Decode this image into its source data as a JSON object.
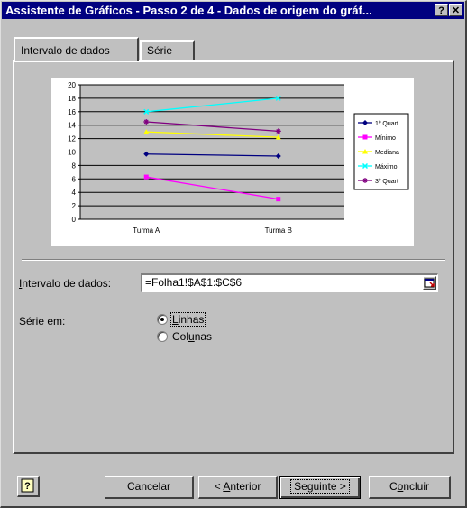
{
  "window": {
    "title": "Assistente de Gráficos - Passo 2 de 4 - Dados de origem do gráf...",
    "help_glyph": "?",
    "close_glyph": "✕"
  },
  "tabs": [
    {
      "label": "Intervalo de dados",
      "active": true
    },
    {
      "label": "Série",
      "active": false
    }
  ],
  "chart_data": {
    "type": "line",
    "categories": [
      "Turma A",
      "Turma B"
    ],
    "ylim": [
      0,
      20
    ],
    "yticks": [
      "0",
      "2",
      "4",
      "6",
      "8",
      "10",
      "12",
      "14",
      "16",
      "18",
      "20"
    ],
    "grid": true,
    "legend_position": "right",
    "series": [
      {
        "name": "1º Quart",
        "values": [
          9.7,
          9.4
        ],
        "color": "#000080",
        "marker": "diamond"
      },
      {
        "name": "Mínimo",
        "values": [
          6.3,
          3.0
        ],
        "color": "#ff00ff",
        "marker": "square"
      },
      {
        "name": "Mediana",
        "values": [
          13.0,
          12.2
        ],
        "color": "#ffff00",
        "marker": "triangle"
      },
      {
        "name": "Máximo",
        "values": [
          16.0,
          18.0
        ],
        "color": "#00ffff",
        "marker": "x"
      },
      {
        "name": "3º Quart",
        "values": [
          14.5,
          13.1
        ],
        "color": "#800080",
        "marker": "star"
      }
    ]
  },
  "form": {
    "range_label_u": "I",
    "range_label_rest": "ntervalo de dados:",
    "range_value": "=Folha1!$A$1:$C$6",
    "series_in_label": "Série em:",
    "options": [
      {
        "pre": "",
        "u": "L",
        "post": "inhas",
        "selected": true
      },
      {
        "pre": "Col",
        "u": "u",
        "post": "nas",
        "selected": false
      }
    ]
  },
  "buttons": {
    "cancel": "Cancelar",
    "back_pre": "< ",
    "back_u": "A",
    "back_post": "nterior",
    "next": "Seguinte >",
    "finish_pre": "C",
    "finish_u": "o",
    "finish_post": "ncluir"
  }
}
